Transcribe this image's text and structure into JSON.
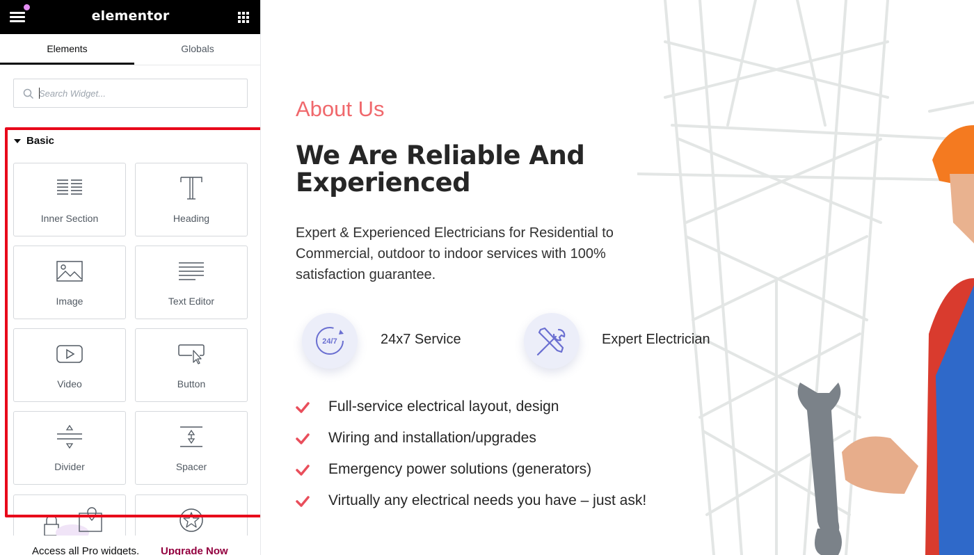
{
  "editor": {
    "logo": "elementor",
    "tabs": {
      "elements": "Elements",
      "globals": "Globals"
    },
    "search": {
      "placeholder": "Search Widget..."
    },
    "category": {
      "label": "Basic"
    },
    "widgets": [
      {
        "label": "Inner Section",
        "icon": "inner-section-icon"
      },
      {
        "label": "Heading",
        "icon": "heading-icon"
      },
      {
        "label": "Image",
        "icon": "image-icon"
      },
      {
        "label": "Text Editor",
        "icon": "text-editor-icon"
      },
      {
        "label": "Video",
        "icon": "video-icon"
      },
      {
        "label": "Button",
        "icon": "button-icon"
      },
      {
        "label": "Divider",
        "icon": "divider-icon"
      },
      {
        "label": "Spacer",
        "icon": "spacer-icon"
      },
      {
        "label": "",
        "icon": "google-maps-icon"
      },
      {
        "label": "",
        "icon": "icon-widget-icon"
      }
    ],
    "promo": {
      "text": "Access all Pro widgets.",
      "link": "Upgrade Now"
    },
    "colors": {
      "topbar": "#000000",
      "highlight": "#e8081b",
      "promo_link": "#93003f",
      "notification": "#e38ef2"
    }
  },
  "page": {
    "about_label": "About Us",
    "headline": "We Are Reliable And Experienced",
    "lead": "Expert & Experienced Electricians for Residential to Commercial, outdoor to indoor services with 100% satisfaction guarantee.",
    "features": [
      {
        "label": "24x7 Service",
        "icon": "24-7-icon",
        "icon_text": "24/7"
      },
      {
        "label": "Expert Electrician",
        "icon": "tools-icon"
      }
    ],
    "checklist": [
      "Full-service electrical layout, design",
      "Wiring and installation/upgrades",
      "Emergency power solutions (generators)",
      "Virtually any electrical needs you have – just ask!"
    ],
    "colors": {
      "accent": "#f0686c",
      "check": "#e94e5b",
      "heading": "#262626",
      "feature_icon": "#6a6fd1"
    }
  }
}
